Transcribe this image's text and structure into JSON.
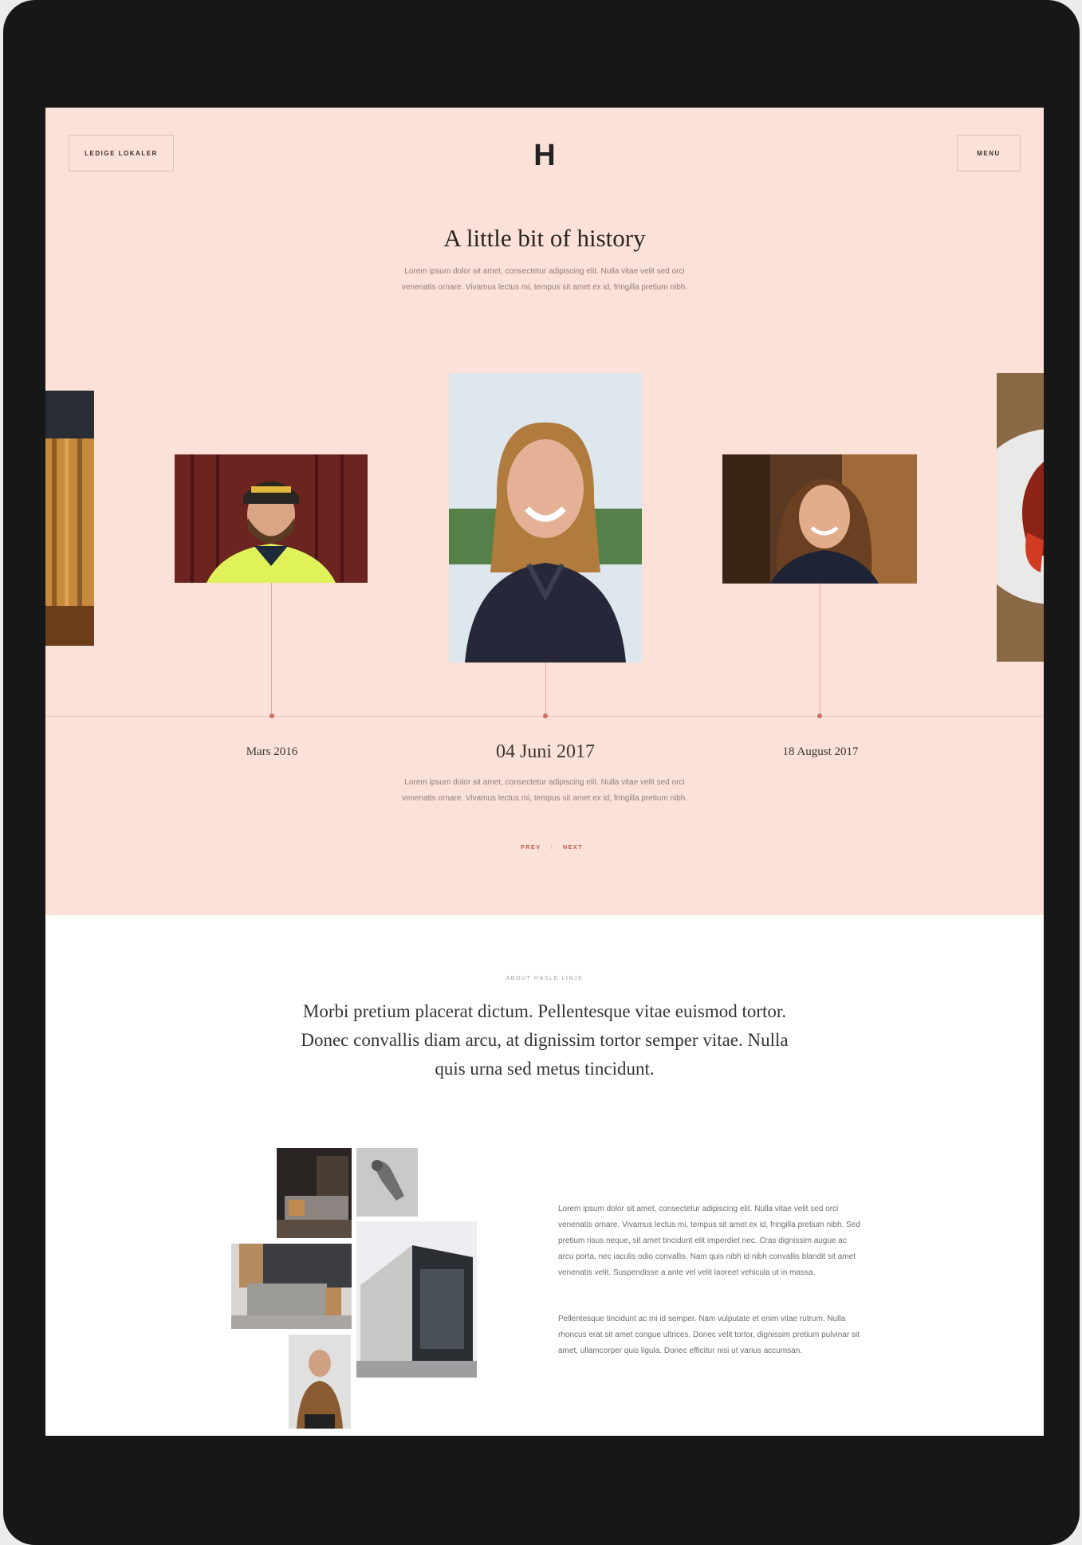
{
  "header": {
    "left_button": "LEDIGE LOKALER",
    "logo": "H",
    "menu_button": "MENU"
  },
  "hero": {
    "title": "A little bit of history",
    "intro": "Lorem ipsum dolor sit amet, consectetur adipiscing elit. Nulla vitae velit sed orci venenatis ornare. Vivamus lectus mi, tempus sit amet ex id, fringilla pretium nibh."
  },
  "timeline": {
    "dates": [
      "Mars 2016",
      "04 Juni 2017",
      "18 August 2017"
    ],
    "active_description": "Lorem ipsum dolor sit amet, consectetur adipiscing elit. Nulla vitae velit sed orci venenatis ornare. Vivamus lectus mi, tempus sit amet ex id, fringilla pretium nibh.",
    "prev_label": "PREV",
    "next_label": "NEXT",
    "separator": "/"
  },
  "about": {
    "label": "ABOUT HASLE LINJE",
    "lead": "Morbi pretium placerat dictum. Pellentesque vitae euismod tortor. Donec convallis diam arcu, at dignissim tortor semper vitae. Nulla quis urna sed metus tincidunt.",
    "paragraph_1": "Lorem ipsum dolor sit amet, consectetur adipiscing elit. Nulla vitae velit sed orci venenatis ornare. Vivamus lectus mi, tempus sit amet ex id, fringilla pretium nibh. Sed pretium risus neque, sit amet tincidunt elit imperdiet nec. Cras dignissim augue ac arcu porta, nec iaculis odio convallis. Nam quis nibh id nibh convallis blandit sit amet venenatis velit. Suspendisse a ante vel velit laoreet vehicula ut in massa.",
    "paragraph_2": "Pellentesque tincidunt ac mi id semper. Nam vulputate et enim vitae rutrum. Nulla rhoncus erat sit amet congue ultrices. Donec velit tortor, dignissim pretium pulvinar sit amet, ullamcorper quis ligula. Donec efficitur nisi ut varius accumsan."
  },
  "colors": {
    "hero_background": "#fbe1d8",
    "accent": "#c96f63",
    "device_frame": "#171717"
  }
}
